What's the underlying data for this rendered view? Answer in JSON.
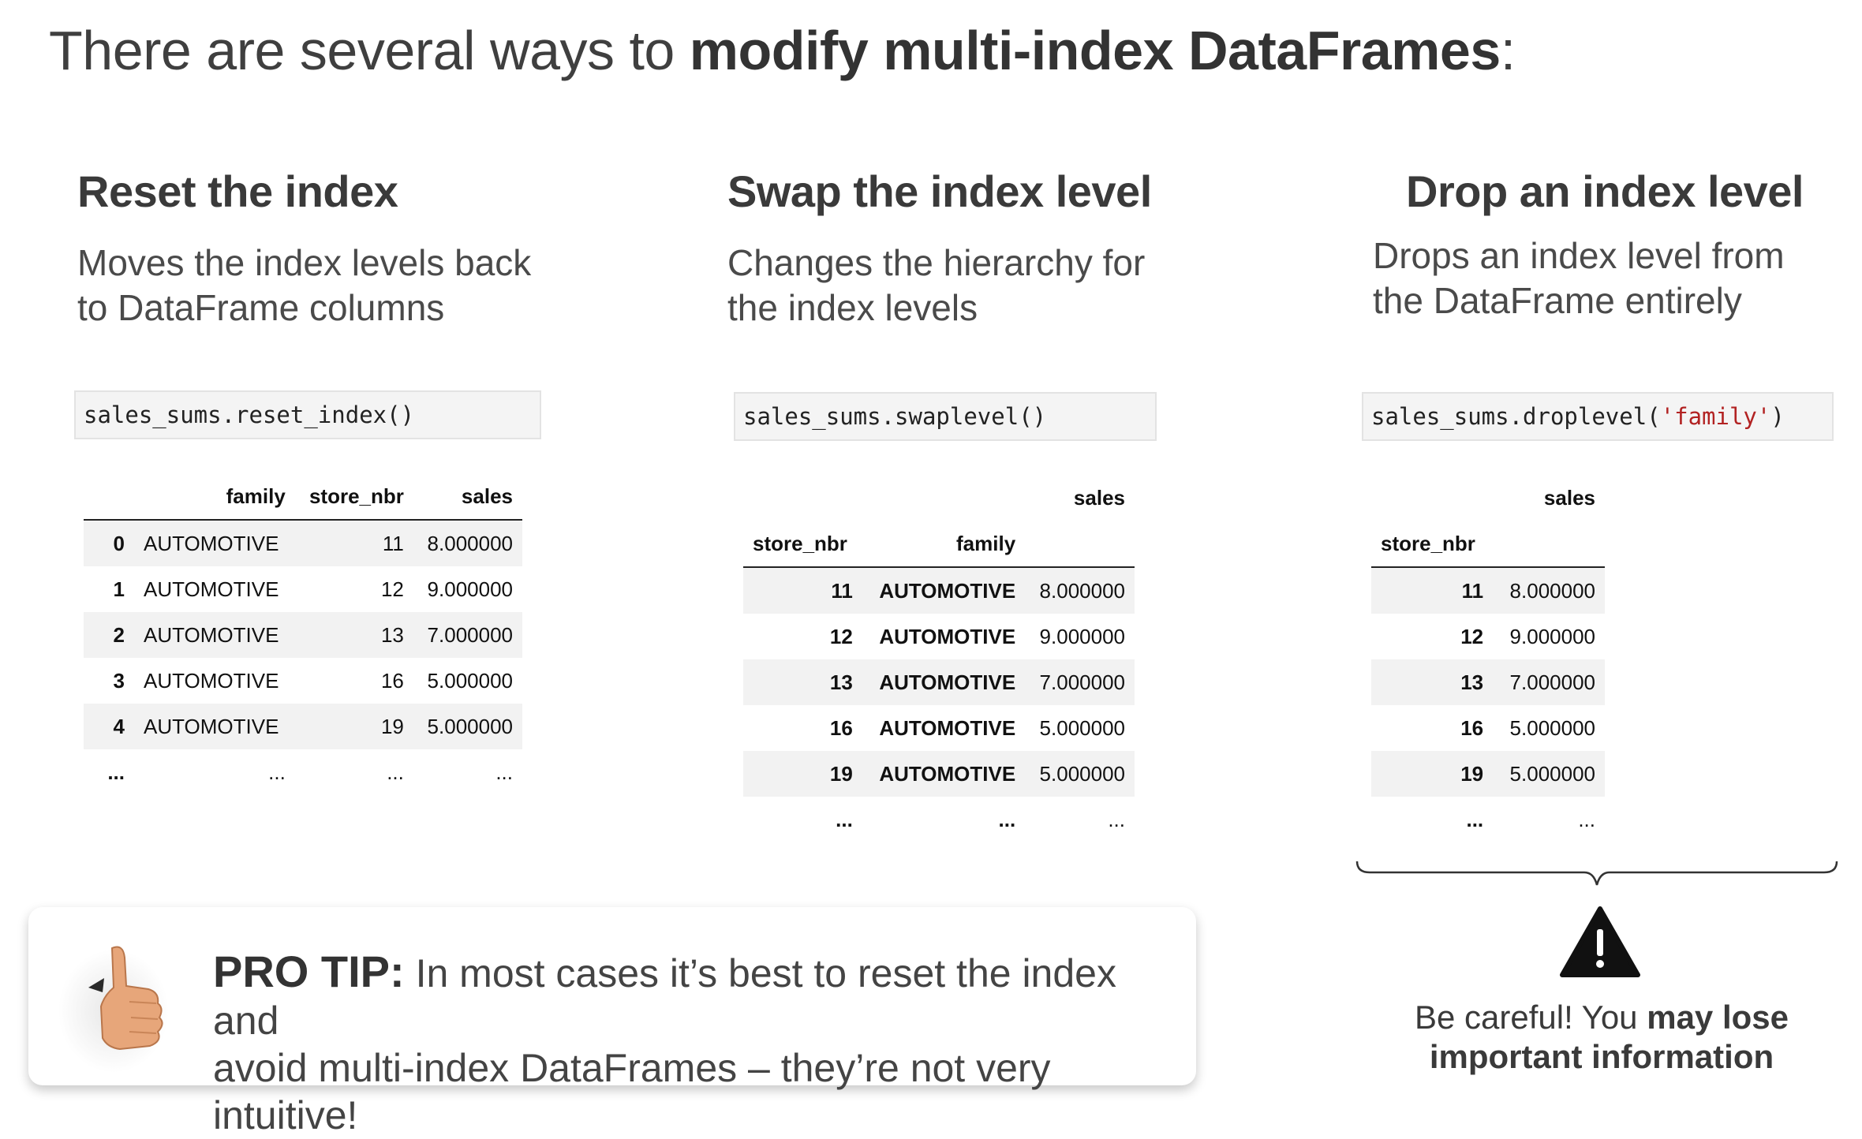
{
  "title": {
    "prefix": "There are several ways to ",
    "bold": "modify multi-index DataFrames",
    "suffix": ":"
  },
  "col_reset": {
    "heading": "Reset the index",
    "desc_line1": "Moves the index levels back",
    "desc_line2": "to DataFrame columns",
    "code": "sales_sums.reset_index()",
    "table": {
      "headers": [
        "",
        "family",
        "store_nbr",
        "sales"
      ],
      "rows": [
        [
          "0",
          "AUTOMOTIVE",
          "11",
          "8.000000"
        ],
        [
          "1",
          "AUTOMOTIVE",
          "12",
          "9.000000"
        ],
        [
          "2",
          "AUTOMOTIVE",
          "13",
          "7.000000"
        ],
        [
          "3",
          "AUTOMOTIVE",
          "16",
          "5.000000"
        ],
        [
          "4",
          "AUTOMOTIVE",
          "19",
          "5.000000"
        ],
        [
          "...",
          "...",
          "...",
          "..."
        ]
      ]
    }
  },
  "col_swap": {
    "heading": "Swap the index level",
    "desc_line1": "Changes the hierarchy for",
    "desc_line2": "the index levels",
    "code": "sales_sums.swaplevel()",
    "table": {
      "value_header": "sales",
      "index_names": [
        "store_nbr",
        "family"
      ],
      "rows": [
        [
          "11",
          "AUTOMOTIVE",
          "8.000000"
        ],
        [
          "12",
          "AUTOMOTIVE",
          "9.000000"
        ],
        [
          "13",
          "AUTOMOTIVE",
          "7.000000"
        ],
        [
          "16",
          "AUTOMOTIVE",
          "5.000000"
        ],
        [
          "19",
          "AUTOMOTIVE",
          "5.000000"
        ],
        [
          "...",
          "...",
          "..."
        ]
      ]
    }
  },
  "col_drop": {
    "heading": "Drop an index level",
    "desc_line1": "Drops an index level from",
    "desc_line2": "the DataFrame entirely",
    "code_prefix": "sales_sums.droplevel(",
    "code_arg": "'family'",
    "code_suffix": ")",
    "table": {
      "value_header": "sales",
      "index_name": "store_nbr",
      "rows": [
        [
          "11",
          "8.000000"
        ],
        [
          "12",
          "9.000000"
        ],
        [
          "13",
          "7.000000"
        ],
        [
          "16",
          "5.000000"
        ],
        [
          "19",
          "5.000000"
        ],
        [
          "...",
          "..."
        ]
      ]
    }
  },
  "pro_tip": {
    "label": "PRO TIP:",
    "line1": " In most cases it’s best to reset the index and",
    "line2": "avoid multi-index DataFrames – they’re not very intuitive!",
    "icon": "thumbs-up-icon"
  },
  "warning": {
    "icon": "warning-icon",
    "text1": "Be careful! You ",
    "bold1": "may lose",
    "bold2": "important information"
  }
}
